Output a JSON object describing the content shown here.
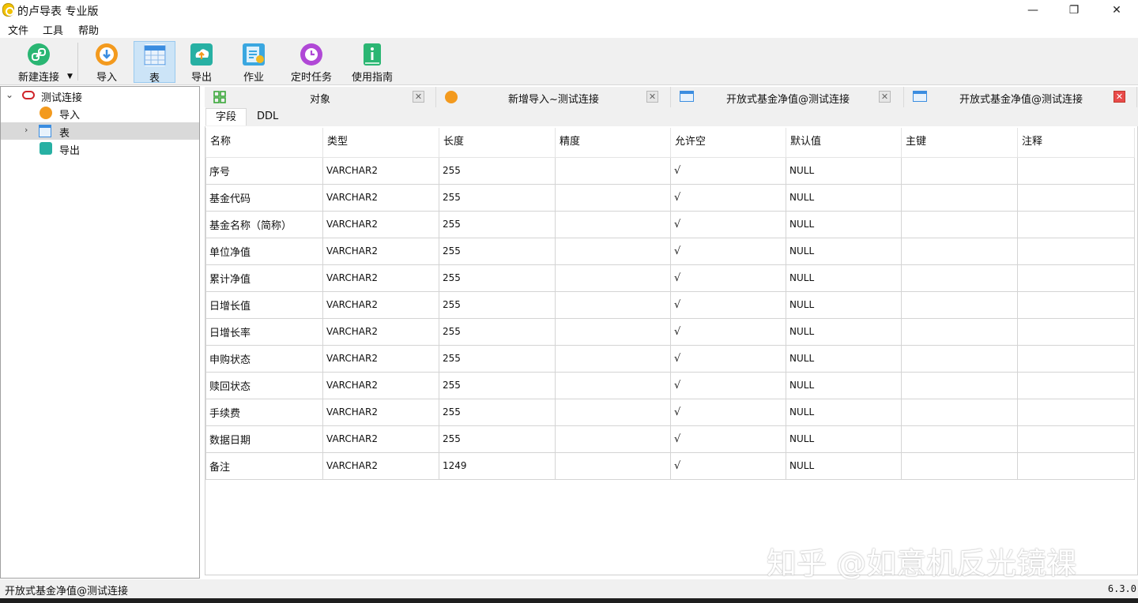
{
  "window": {
    "title": "的卢导表 专业版",
    "minimize": "—",
    "maximize": "❐",
    "close": "✕"
  },
  "menu": [
    "文件",
    "工具",
    "帮助"
  ],
  "toolbar": {
    "buttons": [
      {
        "label": "新建连接",
        "icon": "link-icon",
        "color": "#2ab673"
      },
      {
        "label": "导入",
        "icon": "import-icon",
        "color": "#f39a1e"
      },
      {
        "label": "表",
        "icon": "table-icon",
        "color": "#3b8de0"
      },
      {
        "label": "导出",
        "icon": "export-icon",
        "color": "#27b0a3"
      },
      {
        "label": "作业",
        "icon": "job-icon",
        "color": "#3aa7e0"
      },
      {
        "label": "定时任务",
        "icon": "clock-icon",
        "color": "#b048d6"
      },
      {
        "label": "使用指南",
        "icon": "guide-icon",
        "color": "#2bb673"
      }
    ]
  },
  "tree": {
    "connection": "测试连接",
    "items": [
      "导入",
      "表",
      "导出"
    ]
  },
  "tabs": [
    {
      "label": "对象",
      "icon": "grid-icon"
    },
    {
      "label": "新增导入~测试连接",
      "icon": "import-icon"
    },
    {
      "label": "开放式基金净值@测试连接",
      "icon": "table-icon"
    },
    {
      "label": "开放式基金净值@测试连接",
      "icon": "table-icon"
    }
  ],
  "subtabs": [
    "字段",
    "DDL"
  ],
  "grid": {
    "columns": [
      "名称",
      "类型",
      "长度",
      "精度",
      "允许空",
      "默认值",
      "主键",
      "注释"
    ],
    "rows": [
      [
        "序号",
        "VARCHAR2",
        "255",
        "",
        "√",
        "NULL",
        "",
        ""
      ],
      [
        "基金代码",
        "VARCHAR2",
        "255",
        "",
        "√",
        "NULL",
        "",
        ""
      ],
      [
        "基金名称（简称）",
        "VARCHAR2",
        "255",
        "",
        "√",
        "NULL",
        "",
        ""
      ],
      [
        "单位净值",
        "VARCHAR2",
        "255",
        "",
        "√",
        "NULL",
        "",
        ""
      ],
      [
        "累计净值",
        "VARCHAR2",
        "255",
        "",
        "√",
        "NULL",
        "",
        ""
      ],
      [
        "日增长值",
        "VARCHAR2",
        "255",
        "",
        "√",
        "NULL",
        "",
        ""
      ],
      [
        "日增长率",
        "VARCHAR2",
        "255",
        "",
        "√",
        "NULL",
        "",
        ""
      ],
      [
        "申购状态",
        "VARCHAR2",
        "255",
        "",
        "√",
        "NULL",
        "",
        ""
      ],
      [
        "赎回状态",
        "VARCHAR2",
        "255",
        "",
        "√",
        "NULL",
        "",
        ""
      ],
      [
        "手续费",
        "VARCHAR2",
        "255",
        "",
        "√",
        "NULL",
        "",
        ""
      ],
      [
        "数据日期",
        "VARCHAR2",
        "255",
        "",
        "√",
        "NULL",
        "",
        ""
      ],
      [
        "备注",
        "VARCHAR2",
        "1249",
        "",
        "√",
        "NULL",
        "",
        ""
      ]
    ]
  },
  "watermark": "知乎 @如意机反光镜裸",
  "status": {
    "left": "开放式基金净值@测试连接",
    "version": "6.3.0"
  }
}
